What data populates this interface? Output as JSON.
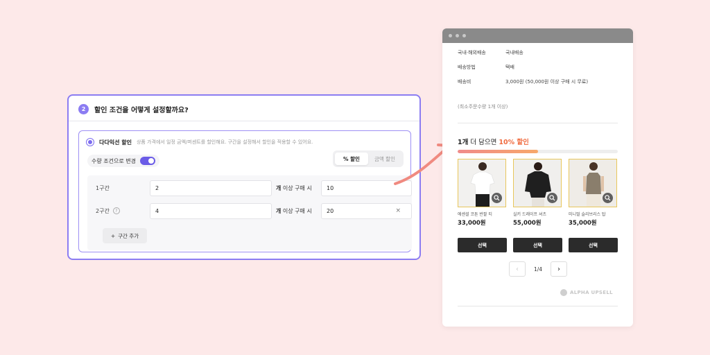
{
  "settings": {
    "step_number": "2",
    "title": "할인 조건을 어떻게 설정할까요?",
    "option_label": "다다익선 할인",
    "option_description": "상품 가격에서 일정 금액/퍼센트를 할인해요. 구간을 설정해서 할인을 적용할 수 있어요.",
    "toggle_label": "수량 조건으로 변경",
    "toggle_on": true,
    "discount_type_tabs": [
      "% 할인",
      "금액 할인"
    ],
    "selected_tab": "% 할인",
    "tiers": [
      {
        "name": "1구간",
        "quantity": "2",
        "unit_prefix": "개",
        "unit_suffix": "이상 구매 시",
        "discount": "10",
        "has_help": false,
        "has_clear": false
      },
      {
        "name": "2구간",
        "quantity": "4",
        "unit_prefix": "개",
        "unit_suffix": "이상 구매 시",
        "discount": "20",
        "has_help": true,
        "has_clear": true
      }
    ],
    "add_tier_label": "구간 추가",
    "help_glyph": "?",
    "clear_glyph": "×",
    "plus_glyph": "+"
  },
  "preview": {
    "info": [
      {
        "key": "국내·해외배송",
        "value": "국내배송"
      },
      {
        "key": "배송방법",
        "value": "택배"
      },
      {
        "key": "배송비",
        "value": "3,000원 (50,000원 이상 구매 시 무료)"
      }
    ],
    "min_order": "(최소주문수량 1개 이상)",
    "promo_qty": "1개",
    "promo_mid": " 더 담으면 ",
    "promo_discount": "10% 할인",
    "progress_fraction": 0.5,
    "products": [
      {
        "name": "에센셜 코튼 반팔 티",
        "price": "33,000원"
      },
      {
        "name": "실키 드레이프 셔츠",
        "price": "55,000원"
      },
      {
        "name": "미니멀 슬리브리스 탑",
        "price": "35,000원"
      }
    ],
    "select_label": "선택",
    "pager_text": "1/4",
    "prev_glyph": "‹",
    "next_glyph": "›",
    "brand": "ALPHA UPSELL"
  },
  "colors": {
    "accent": "#8b7cf2",
    "discount": "#f06b3f",
    "background": "#fde9e9"
  }
}
